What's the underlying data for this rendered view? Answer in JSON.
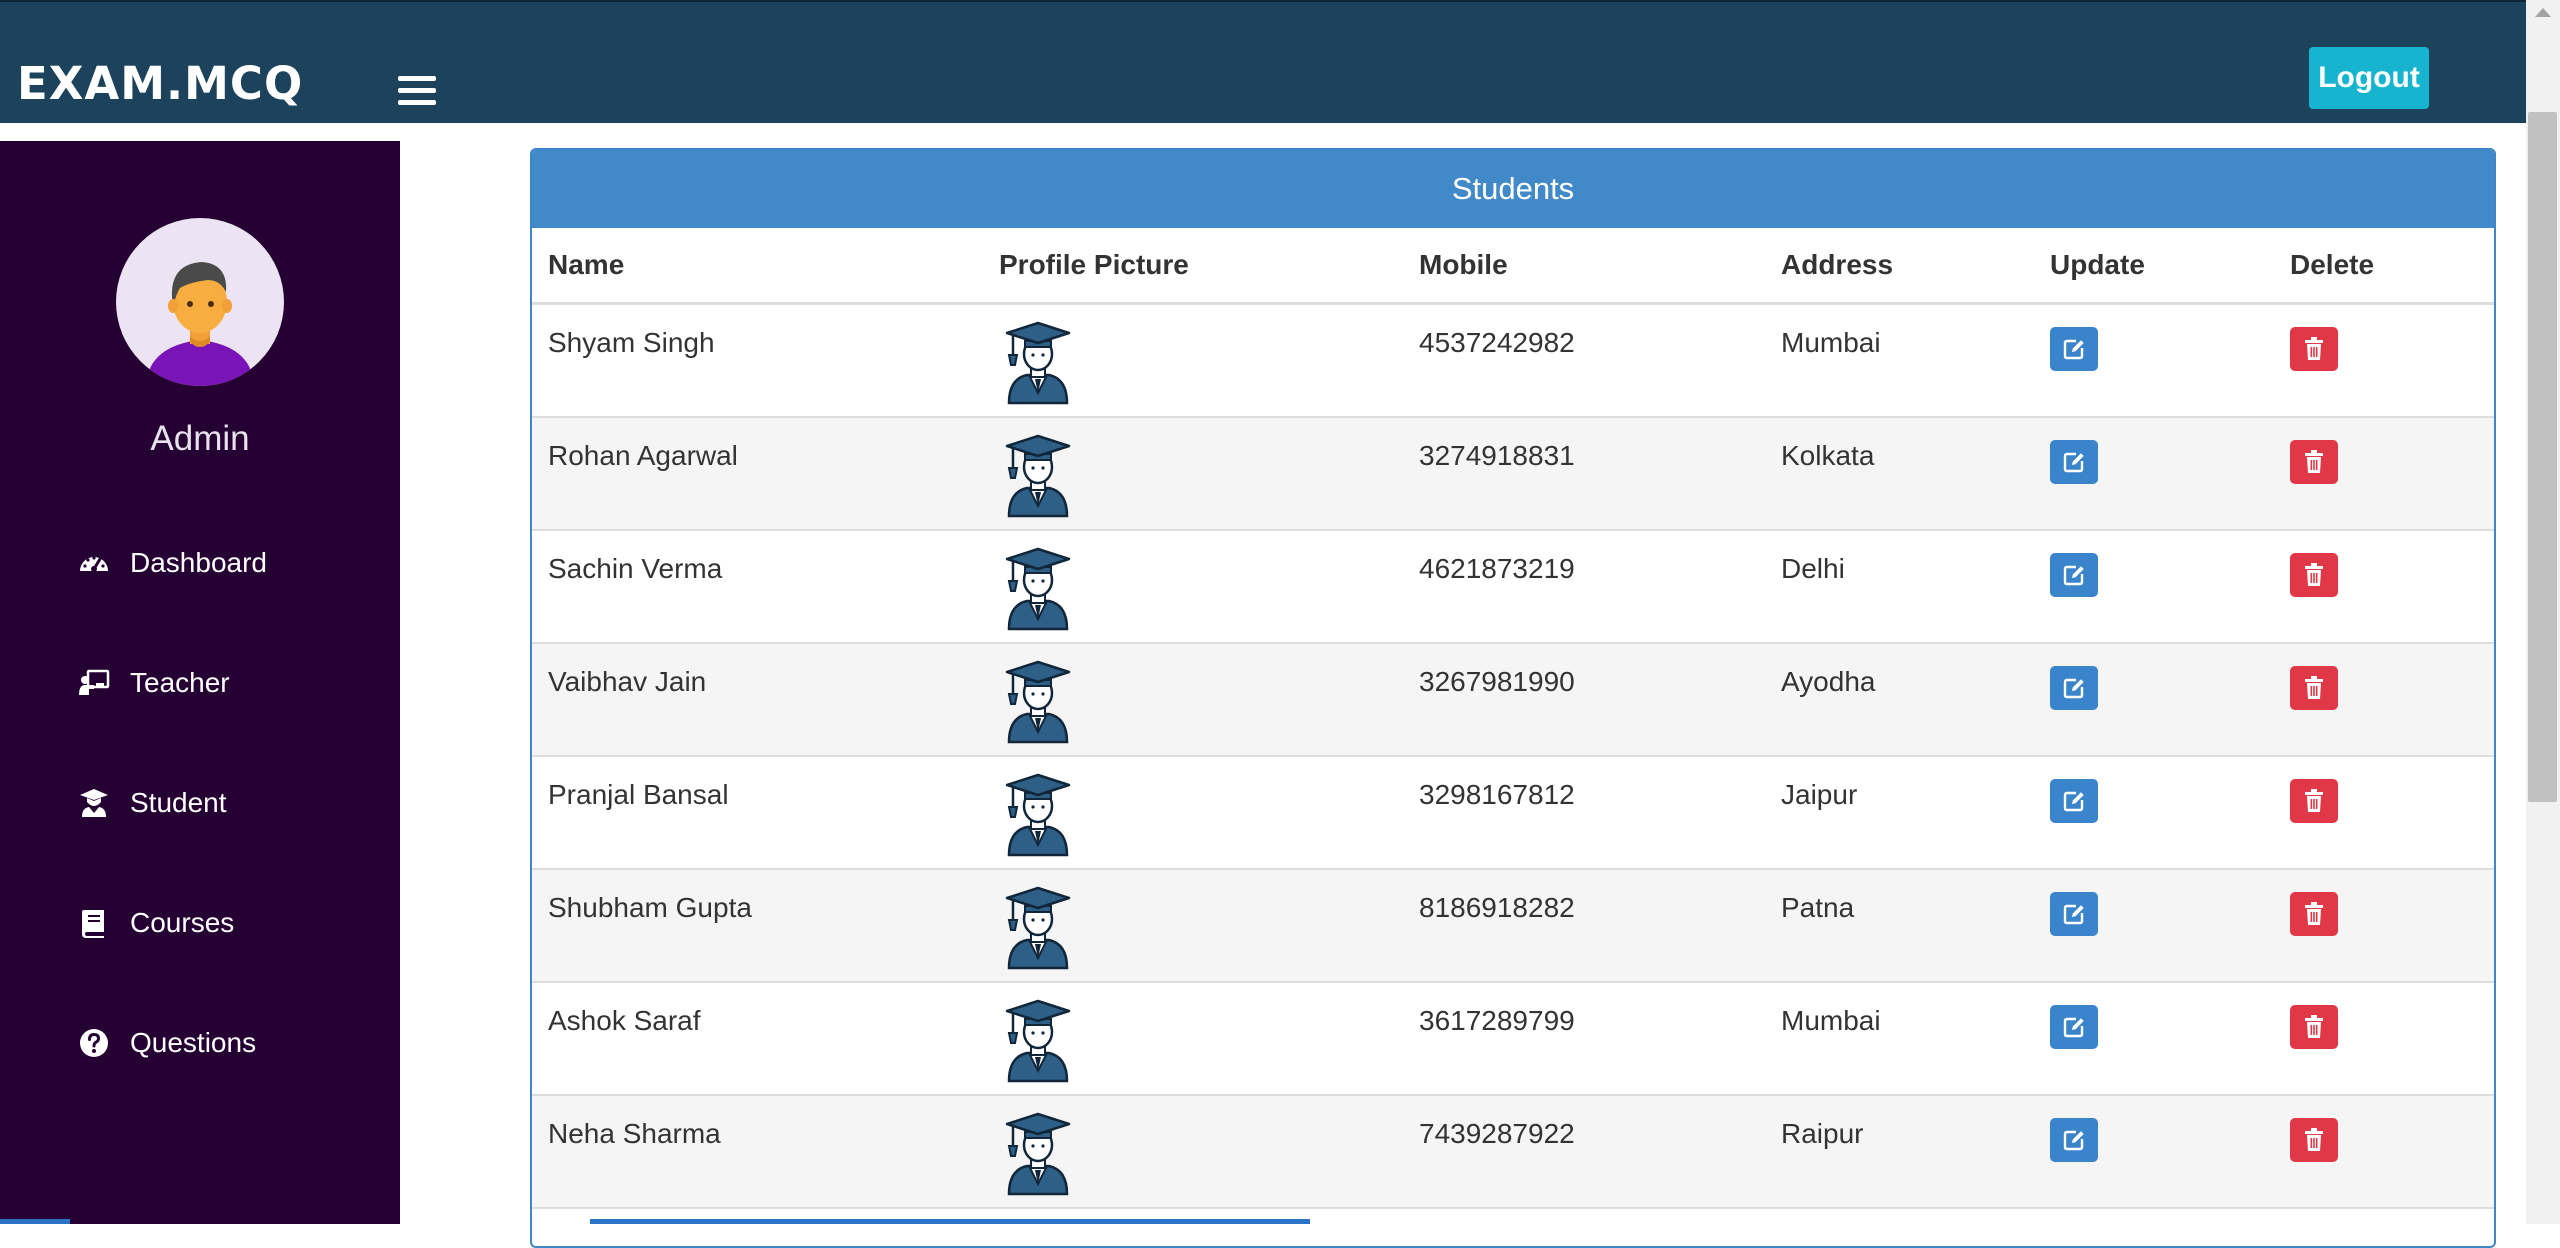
{
  "header": {
    "brand": "EXAM.MCQ",
    "logout_label": "Logout",
    "colors": {
      "bar": "#1c425c",
      "logout": "#17b4cf"
    }
  },
  "sidebar": {
    "admin_name": "Admin",
    "background": "#250033",
    "items": [
      {
        "label": "Dashboard",
        "icon": "dashboard-gauge-icon"
      },
      {
        "label": "Teacher",
        "icon": "teacher-board-icon"
      },
      {
        "label": "Student",
        "icon": "student-graduate-icon"
      },
      {
        "label": "Courses",
        "icon": "book-icon"
      },
      {
        "label": "Questions",
        "icon": "question-circle-icon"
      }
    ]
  },
  "panel": {
    "title": "Students",
    "columns": [
      "Name",
      "Profile Picture",
      "Mobile",
      "Address",
      "Update",
      "Delete"
    ],
    "rows": [
      {
        "name": "Shyam Singh",
        "mobile": "4537242982",
        "address": "Mumbai"
      },
      {
        "name": "Rohan Agarwal",
        "mobile": "3274918831",
        "address": "Kolkata"
      },
      {
        "name": "Sachin Verma",
        "mobile": "4621873219",
        "address": "Delhi"
      },
      {
        "name": "Vaibhav Jain",
        "mobile": "3267981990",
        "address": "Ayodha"
      },
      {
        "name": "Pranjal Bansal",
        "mobile": "3298167812",
        "address": "Jaipur"
      },
      {
        "name": "Shubham Gupta",
        "mobile": "8186918282",
        "address": "Patna"
      },
      {
        "name": "Ashok Saraf",
        "mobile": "3617289799",
        "address": "Mumbai"
      },
      {
        "name": "Neha Sharma",
        "mobile": "7439287922",
        "address": "Raipur"
      }
    ],
    "colors": {
      "header": "#4189c8",
      "update": "#3a84cb",
      "delete": "#e03846"
    }
  }
}
